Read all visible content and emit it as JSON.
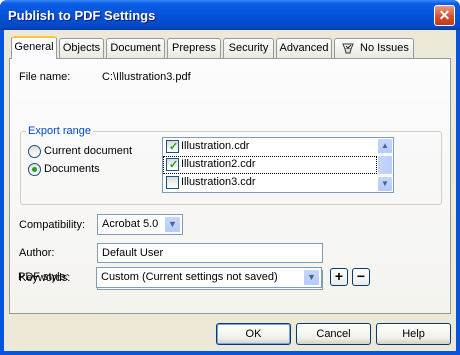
{
  "window": {
    "title": "Publish to PDF Settings",
    "close_glyph": "✕"
  },
  "tabs": [
    {
      "label": "General",
      "active": true
    },
    {
      "label": "Objects"
    },
    {
      "label": "Document"
    },
    {
      "label": "Prepress"
    },
    {
      "label": "Security"
    },
    {
      "label": "Advanced"
    },
    {
      "label": "No Issues",
      "icon": "issues-icon"
    }
  ],
  "general": {
    "file_name_label": "File name:",
    "file_name_value": "C:\\Illustration3.pdf",
    "export_range": {
      "title": "Export range",
      "options": [
        {
          "label": "Current document",
          "selected": false
        },
        {
          "label": "Documents",
          "selected": true
        }
      ],
      "documents": [
        {
          "name": "Illustration.cdr",
          "checked": true
        },
        {
          "name": "Illustration2.cdr",
          "checked": true
        },
        {
          "name": "Illustration3.cdr",
          "checked": false
        }
      ],
      "scroll_up": "▲",
      "scroll_down": "▼"
    },
    "compatibility_label": "Compatibility:",
    "compatibility_value": "Acrobat 5.0",
    "author_label": "Author:",
    "author_value": "Default User",
    "keywords_label": "Keywords:",
    "keywords_value": "",
    "pdf_style_label": "PDF style:",
    "pdf_style_value": "Custom (Current settings not saved)",
    "add_style": "+",
    "remove_style": "−",
    "dropdown_glyph": "▼"
  },
  "buttons": {
    "ok": "OK",
    "cancel": "Cancel",
    "help": "Help"
  },
  "colors": {
    "titlebar": "#0a5ce6",
    "face": "#ece9d8",
    "tab_highlight": "#ffc83c",
    "group_title": "#0046d5"
  }
}
